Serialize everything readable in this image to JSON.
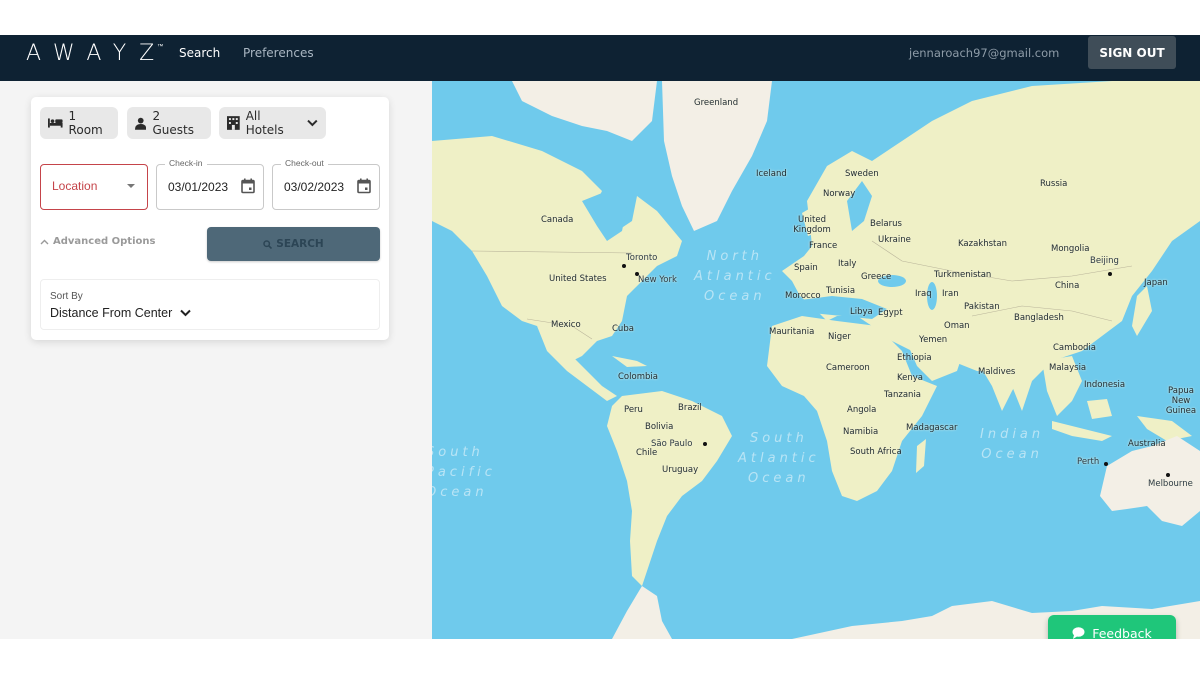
{
  "header": {
    "logo_text": "AWAYZ",
    "logo_tm": "™",
    "nav": [
      {
        "label": "Search",
        "active": true
      },
      {
        "label": "Preferences",
        "active": false
      }
    ],
    "user_email": "jennaroach97@gmail.com",
    "sign_out_label": "SIGN OUT"
  },
  "search_panel": {
    "chips": [
      {
        "icon": "bed-icon",
        "label": "1 Room"
      },
      {
        "icon": "person-icon",
        "label": "2 Guests"
      },
      {
        "icon": "hotel-icon",
        "label": "All Hotels"
      }
    ],
    "location": {
      "placeholder": "Location"
    },
    "checkin": {
      "label": "Check-in",
      "value": "03/01/2023"
    },
    "checkout": {
      "label": "Check-out",
      "value": "03/02/2023"
    },
    "advanced_options_label": "Advanced Options",
    "search_button_label": "SEARCH",
    "sort": {
      "label": "Sort By",
      "value": "Distance From Center"
    }
  },
  "map": {
    "country_labels": [
      "Greenland",
      "Iceland",
      "Canada",
      "United States",
      "Mexico",
      "Cuba",
      "Colombia",
      "Peru",
      "Brazil",
      "Bolivia",
      "Chile",
      "Uruguay",
      "Sweden",
      "Norway",
      "United Kingdom",
      "France",
      "Spain",
      "Italy",
      "Belarus",
      "Ukraine",
      "Greece",
      "Morocco",
      "Tunisia",
      "Libya",
      "Egypt",
      "Mauritania",
      "Niger",
      "Cameroon",
      "Ethiopia",
      "Kenya",
      "Tanzania",
      "Angola",
      "Namibia",
      "South Africa",
      "Madagascar",
      "Russia",
      "Kazakhstan",
      "Turkmenistan",
      "Iraq",
      "Iran",
      "Pakistan",
      "Oman",
      "Yemen",
      "Mongolia",
      "China",
      "Japan",
      "Bangladesh",
      "Cambodia",
      "Malaysia",
      "Indonesia",
      "Papua New Guinea",
      "Maldives",
      "Australia"
    ],
    "city_labels": [
      "Toronto",
      "New York",
      "São Paulo",
      "Beijing",
      "Perth",
      "Melbourne"
    ],
    "ocean_labels": [
      "North Atlantic Ocean",
      "South Atlantic Ocean",
      "Indian Ocean",
      "South Pacific Ocean"
    ],
    "colors": {
      "water": "#6fcaec",
      "land": "#eff0c6",
      "ice": "#f3efe6"
    }
  },
  "feedback_button_label": "Feedback",
  "colors": {
    "topbar": "#0e2233",
    "feedback": "#1fc67a",
    "search_button": "#4e6878",
    "error": "#c5444a"
  }
}
